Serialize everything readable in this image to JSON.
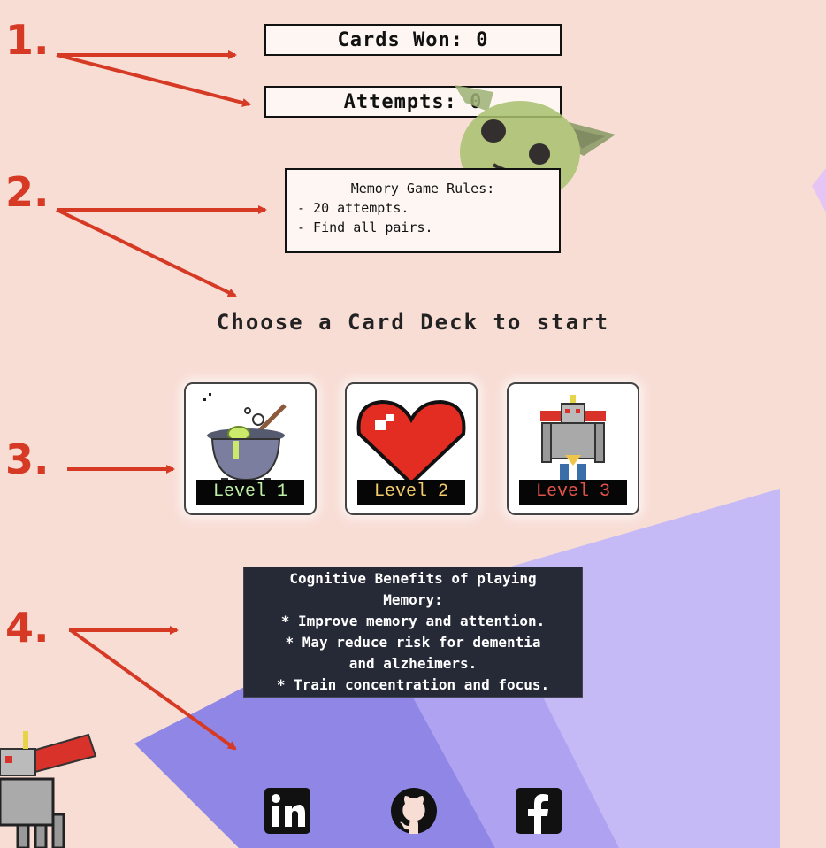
{
  "score": {
    "cards_won": "Cards Won: 0",
    "attempts": "Attempts: 0"
  },
  "rules": {
    "title": "Memory Game Rules:",
    "items": [
      "- 20 attempts.",
      "- Find all pairs."
    ]
  },
  "prompt": "Choose a Card Deck to start",
  "levels": [
    {
      "label": "Level 1",
      "color": "#bdf0a6",
      "icon": "cauldron-icon"
    },
    {
      "label": "Level 2",
      "color": "#f4cc6c",
      "icon": "heart-icon"
    },
    {
      "label": "Level 3",
      "color": "#e4534a",
      "icon": "robot-icon"
    }
  ],
  "benefits": {
    "lines": [
      "Cognitive Benefits of playing",
      "Memory:",
      "* Improve memory and attention.",
      "* May reduce risk for dementia",
      "and alzheimers.",
      "* Train concentration and focus."
    ]
  },
  "annotations": [
    "1.",
    "2.",
    "3.",
    "4."
  ],
  "social": [
    {
      "name": "linkedin-icon",
      "label": "in"
    },
    {
      "name": "github-icon"
    },
    {
      "name": "facebook-icon",
      "label": "f"
    }
  ],
  "colors": {
    "background": "#f8ddd5",
    "accent_red": "#d63a24",
    "shape_dark": "#8f86e6",
    "shape_light": "#c5b8f6"
  }
}
